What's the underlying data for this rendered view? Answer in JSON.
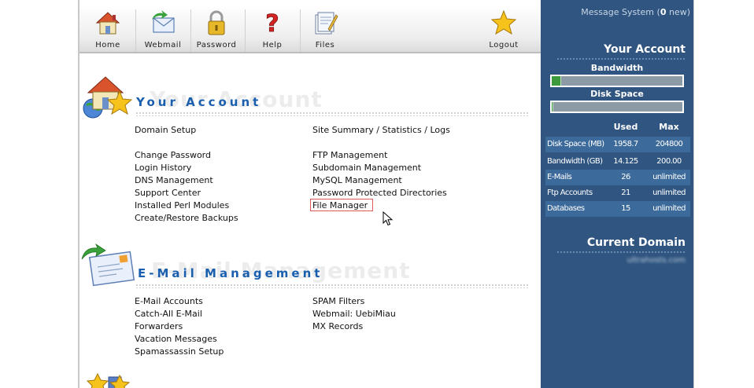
{
  "toolbar": {
    "items": [
      {
        "label": "Home",
        "icon": "home-icon"
      },
      {
        "label": "Webmail",
        "icon": "webmail-icon"
      },
      {
        "label": "Password",
        "icon": "padlock-icon"
      },
      {
        "label": "Help",
        "icon": "help-icon"
      },
      {
        "label": "Files",
        "icon": "files-icon"
      },
      {
        "label": "Logout",
        "icon": "star-icon"
      }
    ]
  },
  "account_section": {
    "title": "Your Account",
    "ghost_title": "Your Account",
    "left_links": [
      "Domain Setup",
      "Change Password",
      "Login History",
      "DNS Management",
      "Support Center",
      "Installed Perl Modules",
      "Create/Restore Backups"
    ],
    "right_links": [
      "Site Summary / Statistics / Logs",
      "FTP Management",
      "Subdomain Management",
      "MySQL Management",
      "Password Protected Directories",
      "File Manager"
    ]
  },
  "email_section": {
    "title": "E-Mail Management",
    "ghost_title": "E-Mail Management",
    "left_links": [
      "E-Mail Accounts",
      "Catch-All E-Mail",
      "Forwarders",
      "Vacation Messages",
      "Spamassassin Setup"
    ],
    "right_links": [
      "SPAM Filters",
      "Webmail: UebiMiau",
      "MX Records"
    ]
  },
  "sidebar": {
    "message_prefix": "Message System (",
    "message_count": "0",
    "message_suffix": " new)",
    "your_account_heading": "Your Account",
    "bandwidth_label": "Bandwidth",
    "bandwidth_fraction": 0.07,
    "disk_label": "Disk Space",
    "disk_fraction": 0.01,
    "col_used": "Used",
    "col_max": "Max",
    "stats": [
      {
        "name": "Disk Space (MB)",
        "used": "1958.7",
        "max": "204800"
      },
      {
        "name": "Bandwidth (GB)",
        "used": "14.125",
        "max": "200.00"
      },
      {
        "name": "E-Mails",
        "used": "26",
        "max": "unlimited"
      },
      {
        "name": "Ftp Accounts",
        "used": "21",
        "max": "unlimited"
      },
      {
        "name": "Databases",
        "used": "15",
        "max": "unlimited"
      }
    ],
    "current_domain_heading": "Current Domain",
    "current_domain_value": "ultrahosts.com"
  },
  "colors": {
    "sidebar_bg": "#2f5580",
    "section_title": "#1a5fae",
    "highlight_box": "#e05a5a",
    "bar_fill": "#3c9a3c"
  }
}
